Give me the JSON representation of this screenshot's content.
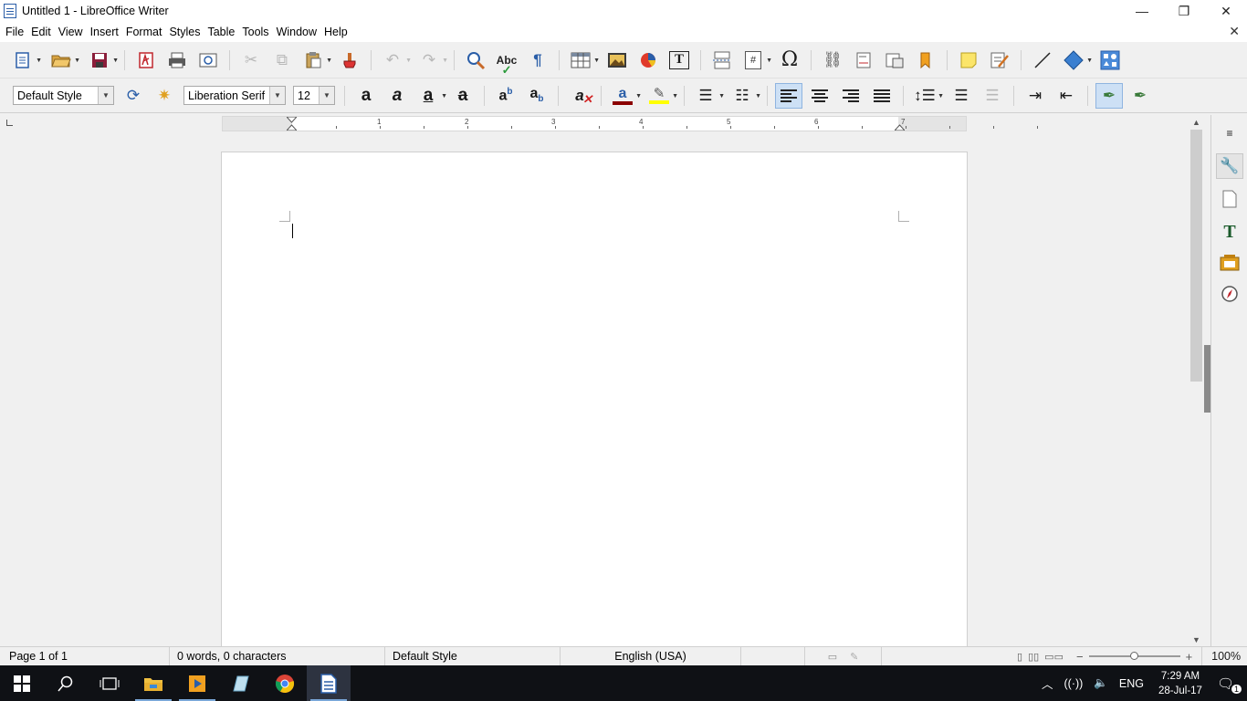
{
  "titlebar": {
    "title": "Untitled 1 - LibreOffice Writer",
    "minimize": "—",
    "restore": "❐",
    "close": "✕"
  },
  "menu": {
    "items": [
      "File",
      "Edit",
      "View",
      "Insert",
      "Format",
      "Styles",
      "Table",
      "Tools",
      "Window",
      "Help"
    ],
    "close_document": "✕"
  },
  "toolbar_format": {
    "paragraph_style": "Default Style",
    "font_name": "Liberation Serif",
    "font_size": "12"
  },
  "ruler": {
    "numbers": [
      "1",
      "2",
      "3",
      "4",
      "5",
      "6",
      "7"
    ]
  },
  "statusbar": {
    "page": "Page 1 of 1",
    "word_count": "0 words, 0 characters",
    "page_style": "Default Style",
    "language": "English (USA)",
    "zoom": "100%",
    "zoom_level": 0.5
  },
  "taskbar": {
    "language": "ENG",
    "time": "7:29 AM",
    "date": "28-Jul-17",
    "notifications": "1"
  },
  "colors": {
    "accent": "#2a5ea8",
    "font_color": "#8b0000",
    "highlight": "#ffff00",
    "taskbar": "#0f1115"
  }
}
